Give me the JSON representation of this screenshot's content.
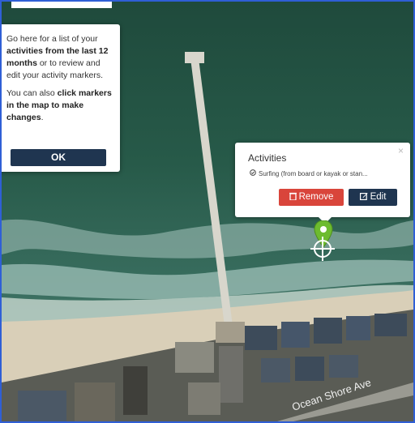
{
  "tooltip": {
    "line1_pre": "Go here for a list of your ",
    "line1_bold": "activities from the last 12 months",
    "line1_post": " or to review and edit your activity markers.",
    "line2_pre": "You can also ",
    "line2_bold": "click markers in the map to make changes",
    "line2_post": ".",
    "ok_label": "OK"
  },
  "popup": {
    "title": "Activities",
    "close_label": "×",
    "activity": "Surfing (from board or kayak or stan...",
    "remove_label": "Remove",
    "edit_label": "Edit"
  },
  "map": {
    "street_label": "Ocean Shore Ave"
  },
  "colors": {
    "frame": "#2f5fd6",
    "remove": "#d9453b",
    "edit": "#1f3550",
    "marker": "#6dbb2f"
  }
}
